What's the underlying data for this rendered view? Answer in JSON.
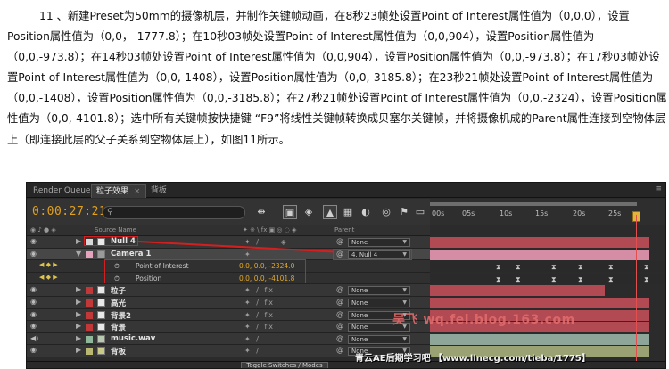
{
  "article": {
    "text": "11 、新建Preset为50mm的摄像机层，并制作关键帧动画，在8秒23帧处设置Point of Interest属性值为（0,0,0），设置Position属性值为（0,0，-1777.8）；在10秒03帧处设置Point of Interest属性值为（0,0,904），设置Position属性值为（0,0,-973.8）；在14秒03帧处设置Point of Interest属性值为（0,0,904），设置Position属性值为（0,0,-973.8）；在17秒03帧处设置Point of Interest属性值为（0,0,-1408），设置Position属性值为（0,0,-3185.8）；在23秒21帧处设置Point of Interest属性值为（0,0,-1408），设置Position属性值为（0,0,-3185.8）；在27秒21帧处设置Point of Interest属性值为（0,0,-2324），设置Position属性值为（0,0,-4101.8）；选中所有关键帧按快捷键 “F9”将线性关键帧转换成贝塞尔关键帧，并将摄像机成的Parent属性连接到空物体层上（即连接此层的父子关系到空物体层上），如图11所示。"
  },
  "ae": {
    "tabs": [
      "Render Queue",
      "粒子效果",
      "背板"
    ],
    "timecode": "0:00:27:21",
    "columns": {
      "source_name": "Source Name",
      "parent": "Parent"
    },
    "ruler_labels": [
      "00s",
      "05s",
      "10s",
      "15s",
      "20s",
      "25s"
    ],
    "layers": [
      {
        "kind": "layer",
        "name": "Null 4",
        "label_color": "#d8d8d8",
        "parent": "None",
        "bar_color": "#b24a53"
      },
      {
        "kind": "layer",
        "name": "Camera 1",
        "label_color": "#e5a4bd",
        "parent": "4. Null 4",
        "bar_color": "#d58da6",
        "selected": true
      },
      {
        "kind": "prop",
        "name": "Point of Interest",
        "value": "0.0, 0.0, -2324.0"
      },
      {
        "kind": "prop",
        "name": "Position",
        "value": "0.0, 0.0, -4101.8"
      },
      {
        "kind": "layer",
        "name": "粒子",
        "label_color": "#c03838",
        "parent": "None",
        "bar_color": "#b24a53"
      },
      {
        "kind": "layer",
        "name": "高光",
        "label_color": "#c03838",
        "parent": "None",
        "bar_color": "#b24a53"
      },
      {
        "kind": "layer",
        "name": "背景2",
        "label_color": "#c03838",
        "parent": "None",
        "bar_color": "#b24a53"
      },
      {
        "kind": "layer",
        "name": "背景",
        "label_color": "#c03838",
        "parent": "None",
        "bar_color": "#b24a53"
      },
      {
        "kind": "layer",
        "name": "music.wav",
        "label_color": "#8fb89a",
        "parent": "None",
        "bar_color": "#8ea69a"
      },
      {
        "kind": "layer",
        "name": "背板",
        "label_color": "#b8b872",
        "parent": "None",
        "bar_color": "#9aa172"
      }
    ],
    "toggle_label": "Toggle Switches / Modes",
    "colors": {
      "timecode": "#e0a020",
      "highlight": "#d22020",
      "value": "#e2a72a"
    }
  },
  "watermarks": {
    "site": "吴飞 wq.fei.blog.163.com",
    "footer": "青云AE后期学习吧 【www.linecg.com/tieba/1775】"
  }
}
